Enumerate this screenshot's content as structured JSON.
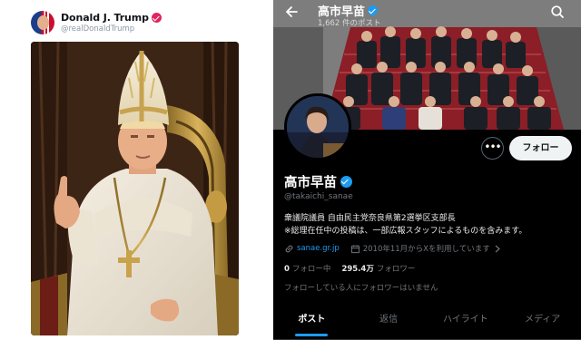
{
  "left_post": {
    "display_name": "Donald J. Trump",
    "handle": "@realDonaldTrump",
    "verified_color": "#e0245e"
  },
  "profile": {
    "header_name": "高市早苗",
    "header_posts": "1,662 件のポスト",
    "name": "高市早苗",
    "handle": "@takaichi_sanae",
    "bio_line1": "衆議院議員 自由民主党奈良県第2選挙区支部長",
    "bio_line2": "※総理在任中の投稿は、一部広報スタッフによるものを含みます。",
    "website": "sanae.gr.jp",
    "joined": "2010年11月からXを利用しています",
    "following_count": "0",
    "following_label": "フォロー中",
    "followers_count": "295.4万",
    "followers_label": "フォロワー",
    "followed_note": "フォローしている人にフォロワーはいません",
    "follow_button": "フォロー",
    "more_button": "•••",
    "verified_color": "#1d9bf0",
    "tabs": [
      {
        "label": "ポスト",
        "active": true
      },
      {
        "label": "返信",
        "active": false
      },
      {
        "label": "ハイライト",
        "active": false
      },
      {
        "label": "メディア",
        "active": false
      }
    ]
  },
  "icons": {
    "back": "arrow-left-icon",
    "search": "search-icon",
    "link": "link-icon",
    "calendar": "calendar-icon",
    "chevron": "chevron-right-icon"
  }
}
